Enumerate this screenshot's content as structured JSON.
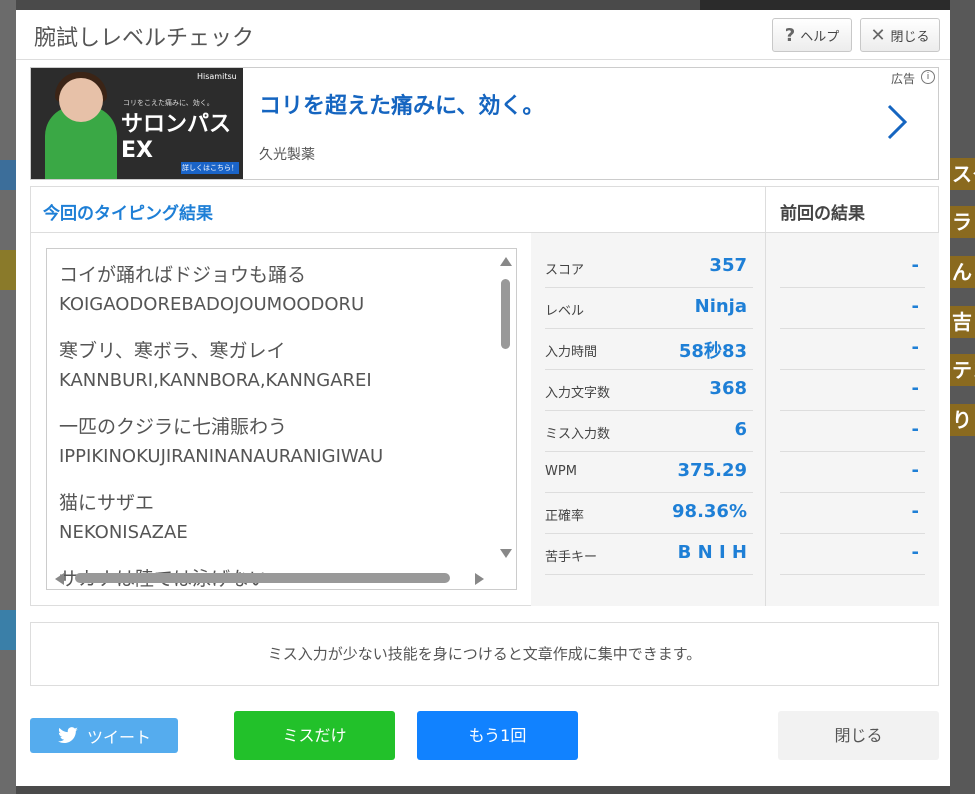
{
  "modal": {
    "title": "腕試しレベルチェック",
    "help_label": "ヘルプ",
    "close_top_label": "閉じる"
  },
  "ad": {
    "headline": "コリを超えた痛みに、効く。",
    "advertiser": "久光製薬",
    "label": "広告",
    "image_text": {
      "brand": "サロンパスEX",
      "tagline": "コリをこえた痛みに、効く。",
      "maker": "Hisamitsu",
      "more": "詳しくはこちら！"
    }
  },
  "results": {
    "current_heading": "今回のタイピング結果",
    "previous_heading": "前回の結果",
    "phrases": [
      {
        "kana": "コイが踊ればドジョウも踊る",
        "romaji": "KOIGAODOREBADOJOUMOODORU"
      },
      {
        "kana": "寒ブリ、寒ボラ、寒ガレイ",
        "romaji": "KANNBURI,KANNBORA,KANNGAREI"
      },
      {
        "kana": "一匹のクジラに七浦賑わう",
        "romaji": "IPPIKINOKUJIRANINANAURANIGIWAU"
      },
      {
        "kana": "猫にサザエ",
        "romaji": "NEKONISAZAE"
      },
      {
        "kana": "サカナは陸では泳げない",
        "romaji": ""
      }
    ],
    "stats": [
      {
        "label": "スコア",
        "value": "357",
        "previous": "-"
      },
      {
        "label": "レベル",
        "value": "Ninja",
        "previous": "-"
      },
      {
        "label": "入力時間",
        "value": "58秒83",
        "previous": "-"
      },
      {
        "label": "入力文字数",
        "value": "368",
        "previous": "-"
      },
      {
        "label": "ミス入力数",
        "value": "6",
        "previous": "-"
      },
      {
        "label": "WPM",
        "value": "375.29",
        "previous": "-"
      },
      {
        "label": "正確率",
        "value": "98.36%",
        "previous": "-"
      },
      {
        "label": "苦手キー",
        "value": "B N I H",
        "previous": "-"
      }
    ]
  },
  "advice": "ミス入力が少ない技能を身につけると文章作成に集中できます。",
  "buttons": {
    "tweet": "ツイート",
    "miss_only": "ミスだけ",
    "retry": "もう1回",
    "close": "閉じる"
  },
  "background": {
    "right_chips": [
      "スタ",
      "ラ",
      "ん",
      "吉",
      "テン",
      "り"
    ],
    "colors": {
      "accent_blue": "#1e7fd6",
      "tweet_blue": "#55acee",
      "miss_green": "#22c12a",
      "retry_blue": "#1182ff"
    }
  }
}
